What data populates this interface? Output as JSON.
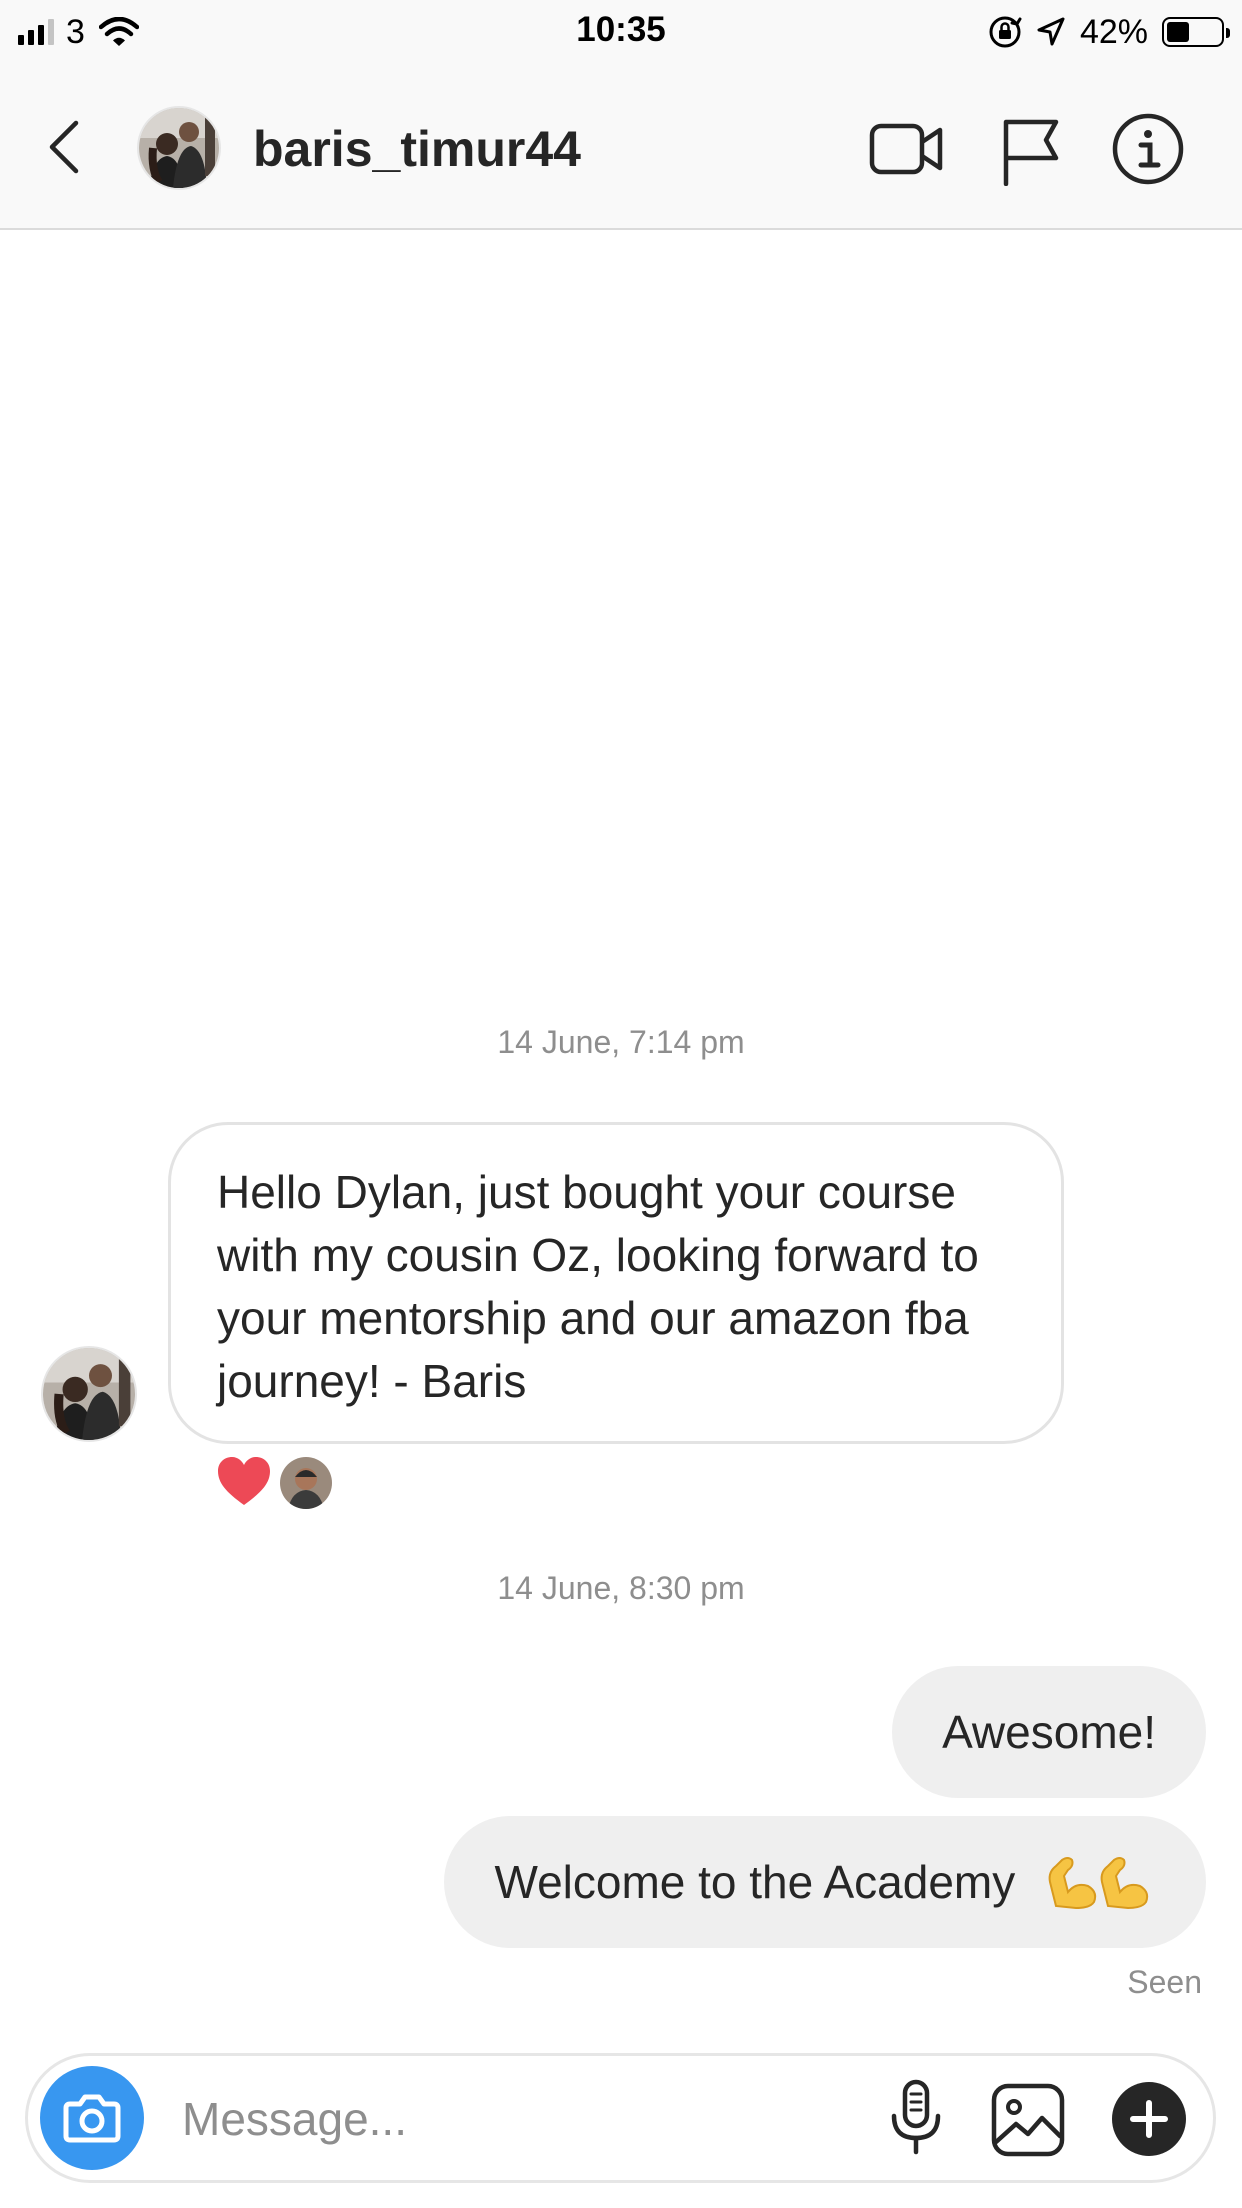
{
  "status_bar": {
    "carrier": "3",
    "time": "10:35",
    "battery_percent": "42%",
    "battery_level": 0.42,
    "signal_bars_active": 3,
    "signal_bars_total": 4
  },
  "header": {
    "username": "baris_timur44",
    "icons": [
      "back-chevron-icon",
      "video-call-icon",
      "flag-icon",
      "info-icon"
    ]
  },
  "thread": {
    "timestamp_1": "14 June, 7:14 pm",
    "incoming_message": "Hello Dylan, just bought your course with my cousin Oz, looking forward to your mentorship and our amazon fba journey! - Baris",
    "reaction": "heart",
    "timestamp_2": "14 June, 8:30 pm",
    "outgoing": [
      {
        "text": "Awesome!",
        "emoji": ""
      },
      {
        "text": "Welcome to the Academy",
        "emoji": "💪💪"
      }
    ],
    "seen_label": "Seen"
  },
  "composer": {
    "placeholder": "Message...",
    "value": ""
  },
  "colors": {
    "accent_blue": "#3897f0",
    "heart_red": "#ed4956",
    "incoming_border": "#e3e3e3",
    "outgoing_bubble": "#efefef",
    "muted_text": "#8e8e8e"
  }
}
